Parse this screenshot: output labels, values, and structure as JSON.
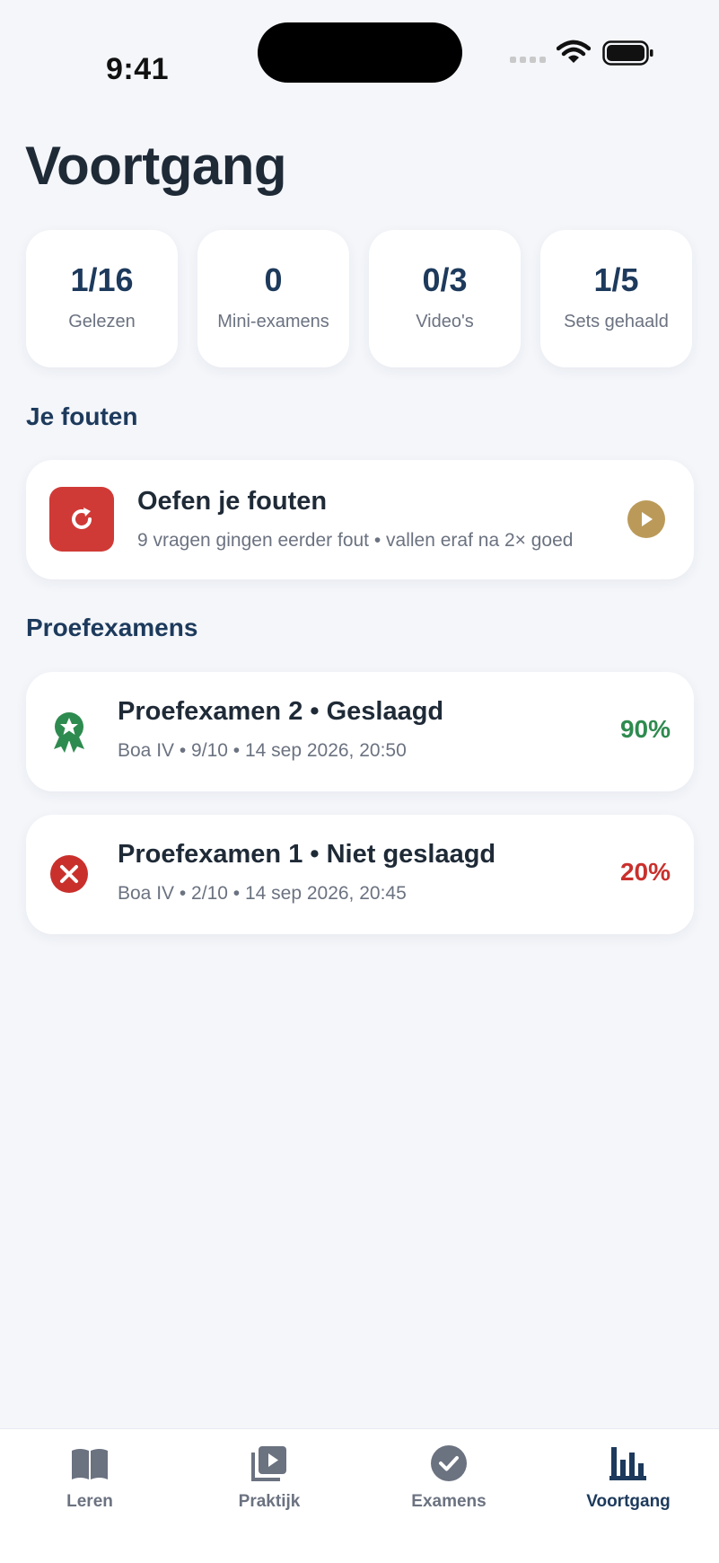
{
  "status_bar": {
    "time": "9:41"
  },
  "page": {
    "title": "Voortgang"
  },
  "stats": [
    {
      "value": "1/16",
      "label": "Gelezen"
    },
    {
      "value": "0",
      "label": "Mini-examens"
    },
    {
      "value": "0/3",
      "label": "Video's"
    },
    {
      "value": "1/5",
      "label": "Sets gehaald"
    }
  ],
  "mistakes": {
    "section_title": "Je fouten",
    "card_title": "Oefen je fouten",
    "card_subtitle": "9 vragen gingen eerder fout • vallen eraf na 2× goed",
    "icon": "retry-icon",
    "action_icon": "play-icon"
  },
  "exams": {
    "section_title": "Proefexamens",
    "items": [
      {
        "title": "Proefexamen 2 • Geslaagd",
        "meta": "Boa IV • 9/10 • 14 sep 2026, 20:50",
        "score": "90%",
        "status": "pass",
        "icon": "award-icon"
      },
      {
        "title": "Proefexamen 1 • Niet geslaagd",
        "meta": "Boa IV • 2/10 • 14 sep 2026, 20:45",
        "score": "20%",
        "status": "fail",
        "icon": "close-circle-icon"
      }
    ]
  },
  "tabs": [
    {
      "label": "Leren",
      "icon": "book-icon",
      "active": false
    },
    {
      "label": "Praktijk",
      "icon": "video-library-icon",
      "active": false
    },
    {
      "label": "Examens",
      "icon": "check-circle-icon",
      "active": false
    },
    {
      "label": "Voortgang",
      "icon": "bar-chart-icon",
      "active": true
    }
  ],
  "colors": {
    "background": "#f4f6fa",
    "navy": "#1d3a5c",
    "danger": "#d03a36",
    "success": "#2e8b4f",
    "gold": "#bb9a59"
  }
}
